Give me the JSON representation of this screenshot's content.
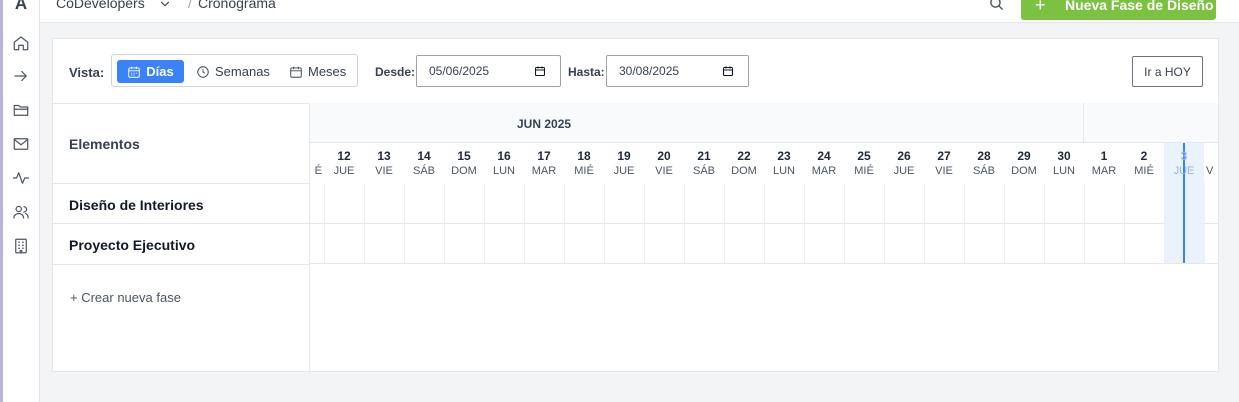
{
  "app": {
    "logo": "A"
  },
  "header": {
    "breadcrumb_root": "CoDevelopers",
    "breadcrumb_sep": "/",
    "breadcrumb_current": "Cronograma",
    "primary_action_icon": "+",
    "primary_action": "Nueva Fase de Diseño"
  },
  "sidebar": {
    "icons": [
      "home-icon",
      "arrow-right-icon",
      "folder-icon",
      "mail-icon",
      "activity-icon",
      "users-icon",
      "building-icon"
    ]
  },
  "toolbar": {
    "vista_label": "Vista:",
    "views": [
      {
        "label": "Días",
        "icon": "calendar-icon",
        "active": true
      },
      {
        "label": "Semanas",
        "icon": "clock-icon",
        "active": false
      },
      {
        "label": "Meses",
        "icon": "calendar-icon",
        "active": false
      }
    ],
    "desde_label": "Desde:",
    "desde_value": "05/06/2025",
    "hasta_label": "Hasta:",
    "hasta_value": "30/08/2025",
    "today_button": "Ir a HOY"
  },
  "grid": {
    "elements_header": "Elementos",
    "rows": [
      "Diseño de Interiores",
      "Proyecto Ejecutivo"
    ],
    "new_phase": "+ Crear nueva fase",
    "month_label": "JUN 2025",
    "partial_left_weekday": "É",
    "days": [
      {
        "num": "12",
        "wd": "JUE"
      },
      {
        "num": "13",
        "wd": "VIE"
      },
      {
        "num": "14",
        "wd": "SÁB"
      },
      {
        "num": "15",
        "wd": "DOM"
      },
      {
        "num": "16",
        "wd": "LUN"
      },
      {
        "num": "17",
        "wd": "MAR"
      },
      {
        "num": "18",
        "wd": "MIÉ"
      },
      {
        "num": "19",
        "wd": "JUE"
      },
      {
        "num": "20",
        "wd": "VIE"
      },
      {
        "num": "21",
        "wd": "SÁB"
      },
      {
        "num": "22",
        "wd": "DOM"
      },
      {
        "num": "23",
        "wd": "LUN"
      },
      {
        "num": "24",
        "wd": "MAR"
      },
      {
        "num": "25",
        "wd": "MIÉ"
      },
      {
        "num": "26",
        "wd": "JUE"
      },
      {
        "num": "27",
        "wd": "VIE"
      },
      {
        "num": "28",
        "wd": "SÁB"
      },
      {
        "num": "29",
        "wd": "DOM"
      },
      {
        "num": "30",
        "wd": "LUN"
      },
      {
        "num": "1",
        "wd": "MAR"
      },
      {
        "num": "2",
        "wd": "MIÉ"
      },
      {
        "num": "3",
        "wd": "JUE",
        "today": true
      },
      {
        "num": "",
        "wd": "V"
      }
    ]
  },
  "colors": {
    "primary_green": "#7cc142",
    "active_blue": "#3b82f6",
    "today_bg": "#eaf2fe"
  }
}
